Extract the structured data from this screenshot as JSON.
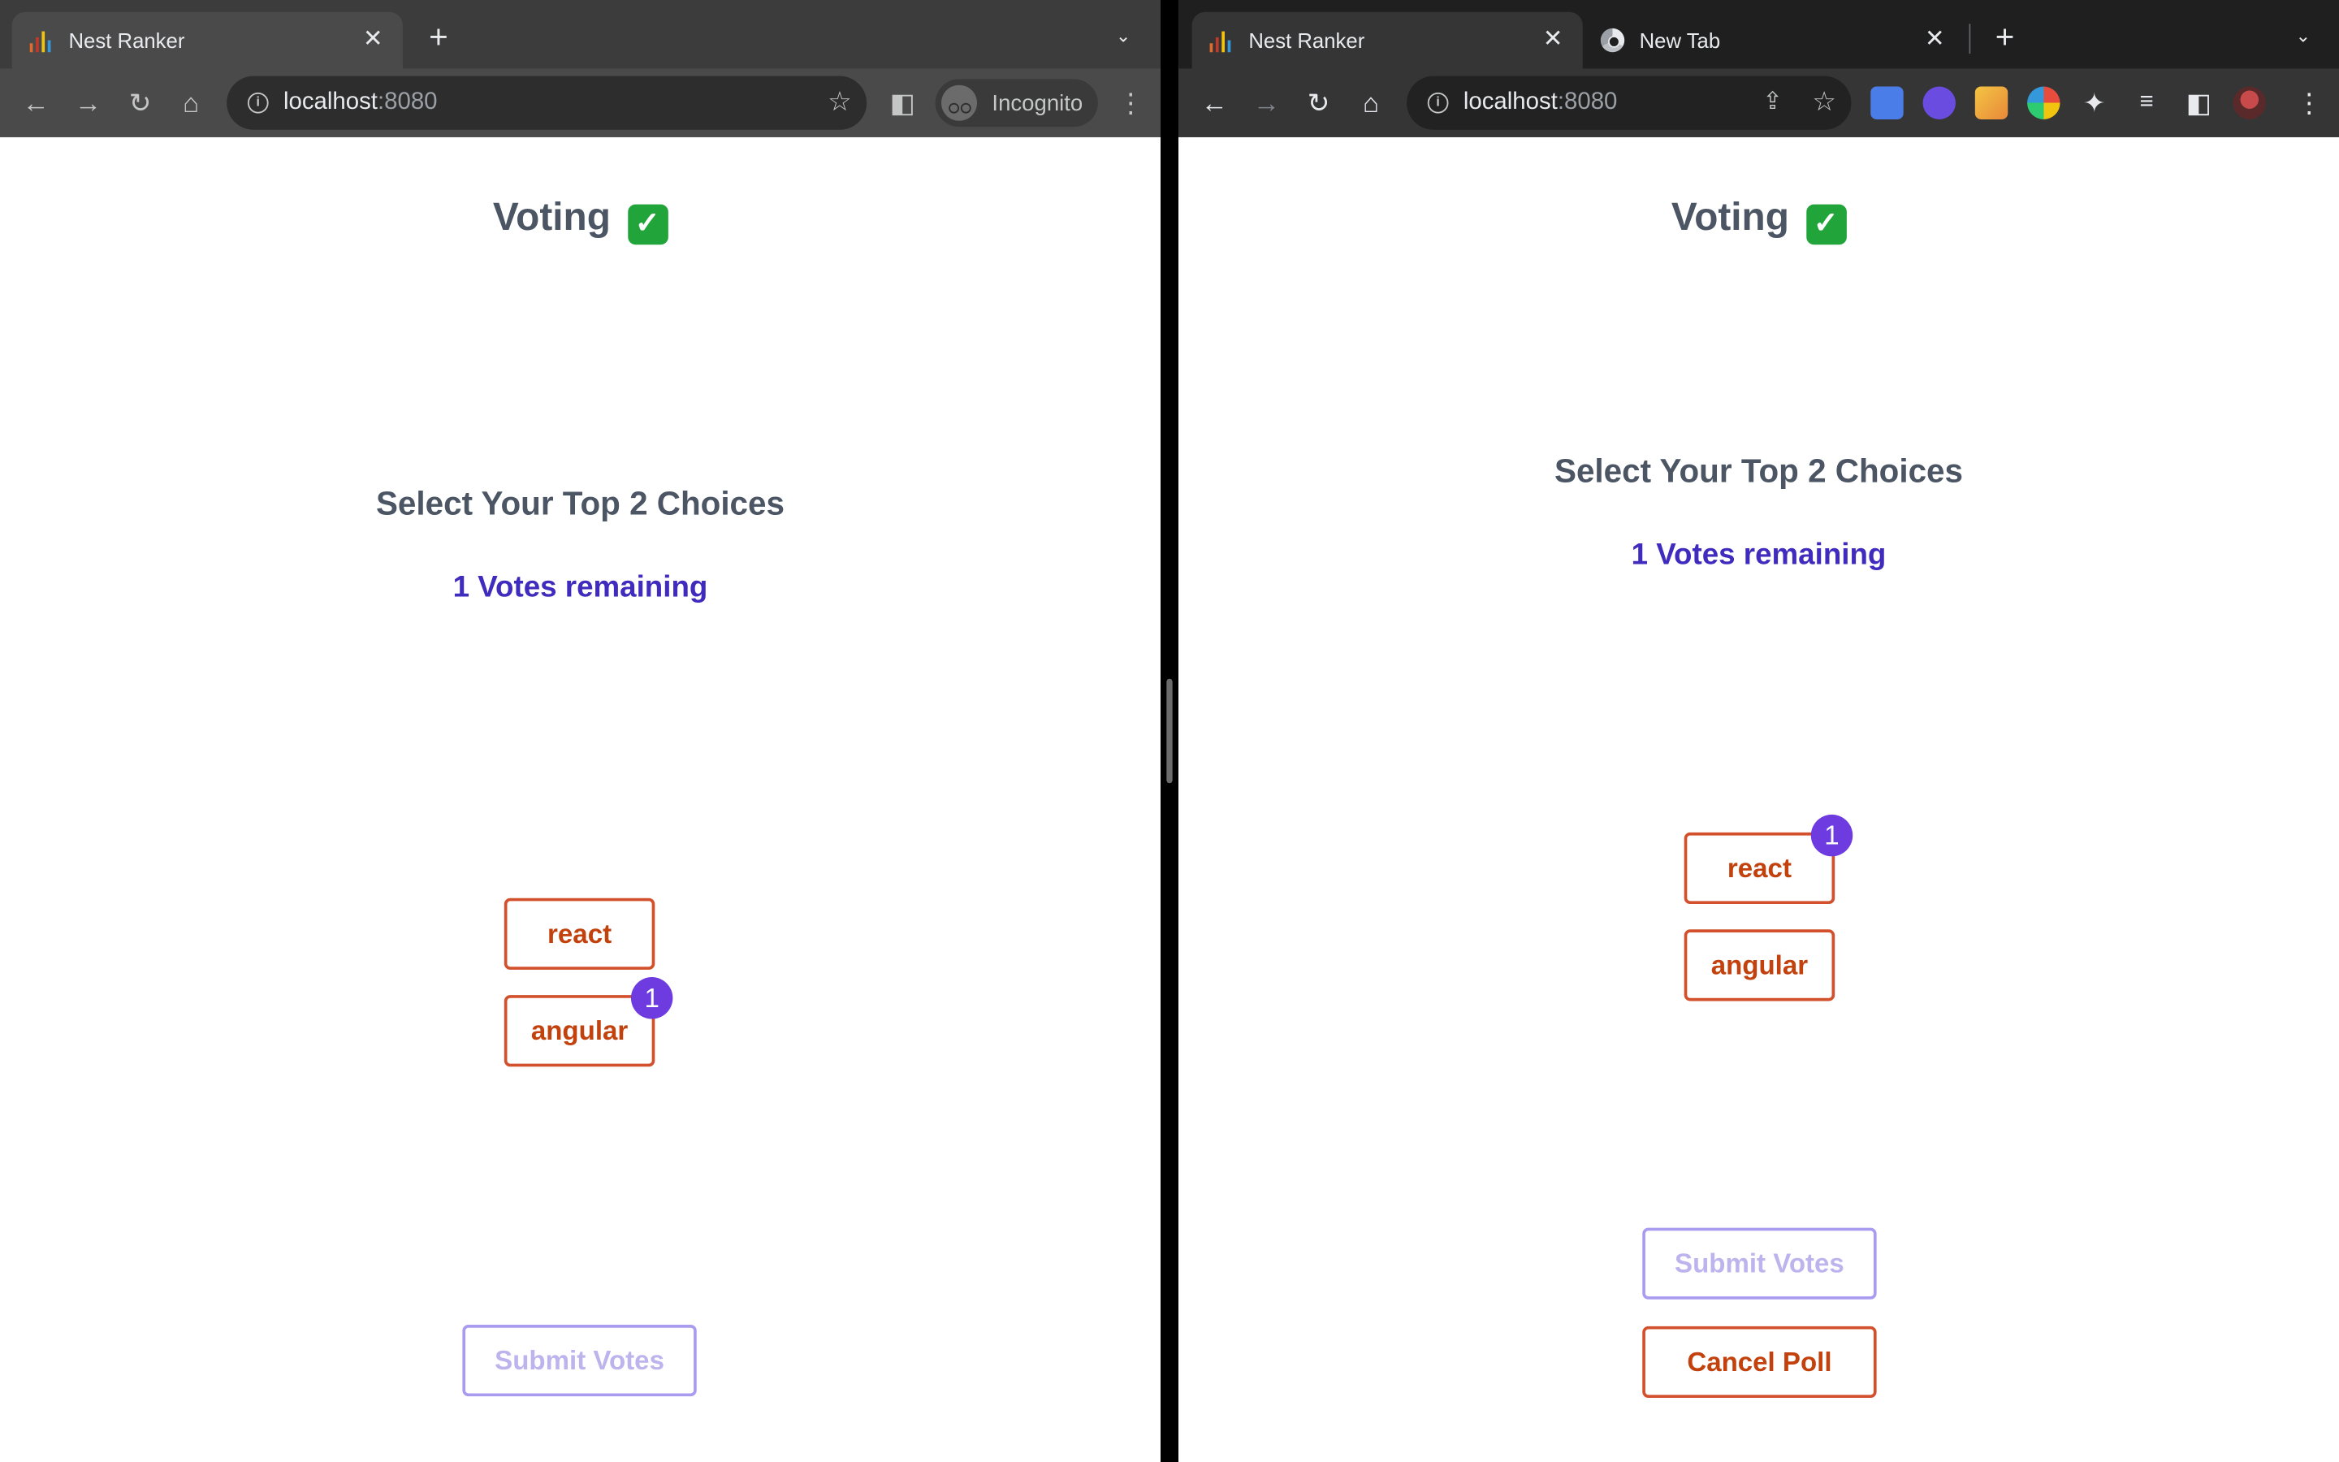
{
  "left_window": {
    "tab": {
      "title": "Nest Ranker",
      "close": "✕"
    },
    "new_tab": "+",
    "tab_menu": "⌄",
    "address": {
      "host": "localhost",
      "port": ":8080"
    },
    "incognito_label": "Incognito",
    "page": {
      "title": "Voting",
      "title_emoji": "✓",
      "heading": "Select Your Top 2 Choices",
      "votes_remaining": "1 Votes remaining",
      "choices": [
        {
          "label": "react",
          "badge": ""
        },
        {
          "label": "angular",
          "badge": "1"
        }
      ],
      "submit_label": "Submit Votes"
    }
  },
  "right_window": {
    "tabs": [
      {
        "title": "Nest Ranker",
        "close": "✕"
      },
      {
        "title": "New Tab",
        "close": "✕"
      }
    ],
    "new_tab": "+",
    "tab_menu": "⌄",
    "address": {
      "host": "localhost",
      "port": ":8080"
    },
    "page": {
      "title": "Voting",
      "title_emoji": "✓",
      "heading": "Select Your Top 2 Choices",
      "votes_remaining": "1 Votes remaining",
      "choices": [
        {
          "label": "react",
          "badge": "1"
        },
        {
          "label": "angular",
          "badge": ""
        }
      ],
      "submit_label": "Submit Votes",
      "cancel_label": "Cancel Poll"
    }
  },
  "icons": {
    "back": "←",
    "forward": "→",
    "reload": "↻",
    "home": "⌂",
    "star": "☆",
    "share": "⇪",
    "sidepanel": "◧",
    "kebab": "⋮",
    "puzzle": "✦"
  },
  "colors": {
    "accent_purple": "#6d3be0",
    "remaining_text": "#3f2bbd",
    "choice_border": "#d2502c",
    "choice_text": "#c2410c",
    "submit_disabled_border": "#a99cf0",
    "check_green": "#21a43a"
  }
}
